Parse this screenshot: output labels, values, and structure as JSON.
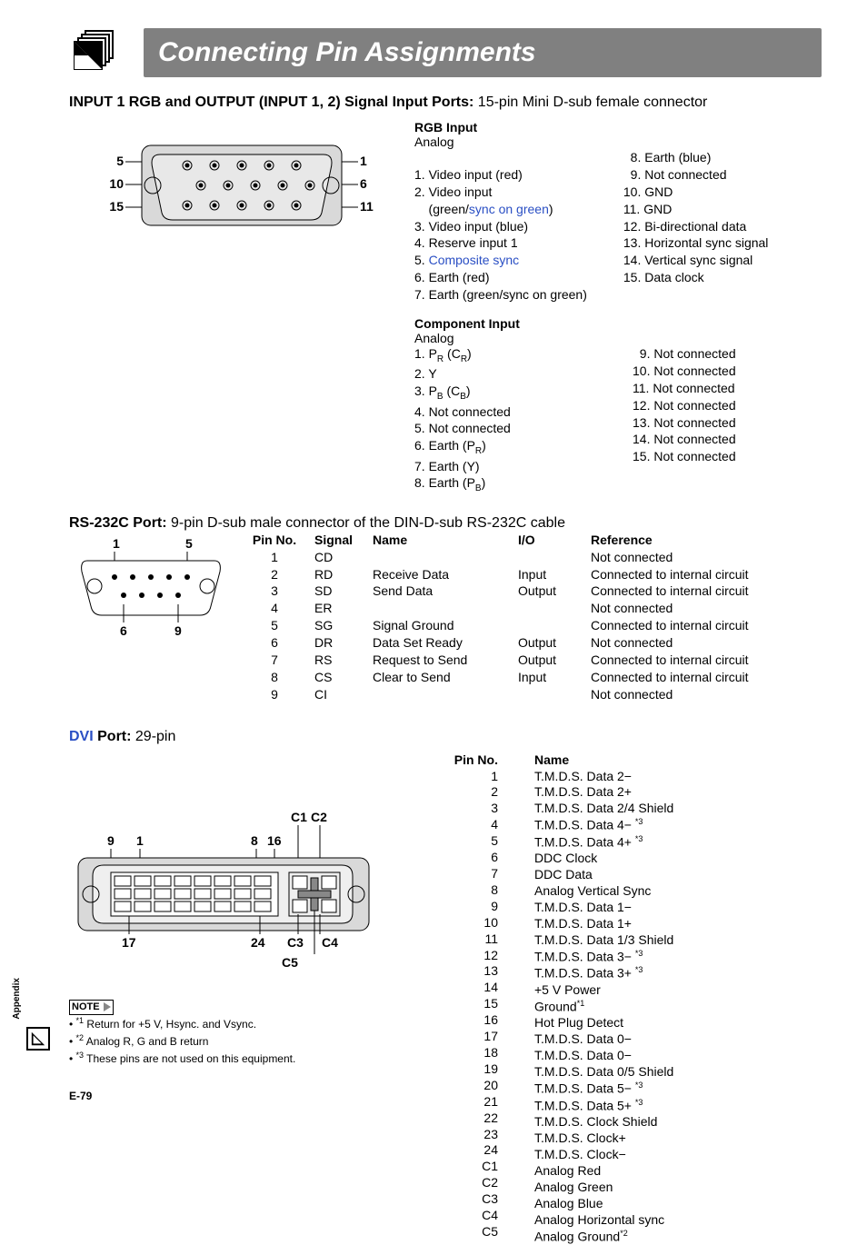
{
  "title": "Connecting Pin Assignments",
  "sideTab": "Appendix",
  "pageNum": "E-79",
  "sec1": {
    "heading_bold": "INPUT 1 RGB and OUTPUT (INPUT 1, 2) Signal Input Ports:",
    "heading_rest": " 15-pin Mini D-sub female connector",
    "rgb_head": "RGB Input",
    "rgb_sub": "Analog",
    "rgb_left": [
      "1. Video input (red)",
      "2. Video input",
      "    (green/",
      "3. Video input (blue)",
      "4. Reserve input 1",
      "5. ",
      "6. Earth (red)",
      "7. Earth (green/sync on green)"
    ],
    "rgb_sync_on_green": "sync on green",
    "rgb_close": ")",
    "rgb_composite": "Composite sync",
    "rgb_right": [
      "  8. Earth (blue)",
      "  9. Not connected",
      "10. GND",
      "11. GND",
      "12. Bi-directional data",
      "13. Horizontal sync signal",
      "14. Vertical sync signal",
      "15. Data clock"
    ],
    "comp_head": "Component Input",
    "comp_sub": "Analog",
    "comp_left_pre": "1. P",
    "comp": {
      "l1a": "1. P",
      "l1b": "R",
      "l1c": " (C",
      "l1d": "R",
      "l1e": ")",
      "l2": "2. Y",
      "l3a": "3. P",
      "l3b": "B",
      "l3c": " (C",
      "l3d": "B",
      "l3e": ")",
      "l4": "4. Not connected",
      "l5": "5. Not connected",
      "l6a": "6. Earth (P",
      "l6b": "R",
      "l6c": ")",
      "l7": "7. Earth (Y)",
      "l8a": "8. Earth (P",
      "l8b": "B",
      "l8c": ")"
    },
    "comp_right": [
      "  9. Not connected",
      "10. Not connected",
      "11. Not connected",
      "12. Not connected",
      "13. Not connected",
      "14. Not connected",
      "15. Not connected"
    ]
  },
  "sec2": {
    "heading_bold": "RS-232C Port:",
    "heading_rest": " 9-pin D-sub male connector of the DIN-D-sub RS-232C cable",
    "head": {
      "pin": "Pin No.",
      "sig": "Signal",
      "name": "Name",
      "io": "I/O",
      "ref": "Reference"
    },
    "rows": [
      {
        "pin": "1",
        "sig": "CD",
        "name": "",
        "io": "",
        "ref": "Not connected"
      },
      {
        "pin": "2",
        "sig": "RD",
        "name": "Receive Data",
        "io": "Input",
        "ref": "Connected to internal circuit"
      },
      {
        "pin": "3",
        "sig": "SD",
        "name": "Send Data",
        "io": "Output",
        "ref": "Connected to internal circuit"
      },
      {
        "pin": "4",
        "sig": "ER",
        "name": "",
        "io": "",
        "ref": "Not connected"
      },
      {
        "pin": "5",
        "sig": "SG",
        "name": "Signal Ground",
        "io": "",
        "ref": "Connected to internal circuit"
      },
      {
        "pin": "6",
        "sig": "DR",
        "name": "Data Set Ready",
        "io": "Output",
        "ref": "Not connected"
      },
      {
        "pin": "7",
        "sig": "RS",
        "name": "Request to Send",
        "io": "Output",
        "ref": "Connected to internal circuit"
      },
      {
        "pin": "8",
        "sig": "CS",
        "name": "Clear to Send",
        "io": "Input",
        "ref": "Connected to internal circuit"
      },
      {
        "pin": "9",
        "sig": "CI",
        "name": "",
        "io": "",
        "ref": "Not connected"
      }
    ]
  },
  "sec3": {
    "heading_link": "DVI",
    "heading_bold": " Port:",
    "heading_rest": " 29-pin",
    "head": {
      "pin": "Pin No.",
      "name": "Name"
    },
    "rows": [
      {
        "pin": "1",
        "name": "T.M.D.S. Data 2−"
      },
      {
        "pin": "2",
        "name": "T.M.D.S. Data 2+"
      },
      {
        "pin": "3",
        "name": "T.M.D.S. Data 2/4 Shield"
      },
      {
        "pin": "4",
        "name": "T.M.D.S. Data 4− ",
        "sup": "*3"
      },
      {
        "pin": "5",
        "name": "T.M.D.S. Data 4+ ",
        "sup": "*3"
      },
      {
        "pin": "6",
        "name": "DDC Clock"
      },
      {
        "pin": "7",
        "name": "DDC Data"
      },
      {
        "pin": "8",
        "name": "Analog Vertical Sync"
      },
      {
        "pin": "9",
        "name": "T.M.D.S. Data 1−"
      },
      {
        "pin": "10",
        "name": "T.M.D.S. Data 1+"
      },
      {
        "pin": "11",
        "name": "T.M.D.S. Data 1/3 Shield"
      },
      {
        "pin": "12",
        "name": "T.M.D.S. Data 3− ",
        "sup": "*3"
      },
      {
        "pin": "13",
        "name": "T.M.D.S. Data 3+ ",
        "sup": "*3"
      },
      {
        "pin": "14",
        "name": "+5 V Power"
      },
      {
        "pin": "15",
        "name": "Ground",
        "sup": "*1"
      },
      {
        "pin": "16",
        "name": "Hot Plug Detect"
      },
      {
        "pin": "17",
        "name": "T.M.D.S. Data 0−"
      },
      {
        "pin": "18",
        "name": "T.M.D.S. Data 0−"
      },
      {
        "pin": "19",
        "name": "T.M.D.S. Data 0/5 Shield"
      },
      {
        "pin": "20",
        "name": "T.M.D.S. Data 5− ",
        "sup": "*3"
      },
      {
        "pin": "21",
        "name": "T.M.D.S. Data 5+ ",
        "sup": "*3"
      },
      {
        "pin": "22",
        "name": "T.M.D.S. Clock Shield"
      },
      {
        "pin": "23",
        "name": "T.M.D.S. Clock+"
      },
      {
        "pin": "24",
        "name": "T.M.D.S. Clock−"
      },
      {
        "pin": "C1",
        "name": "Analog Red"
      },
      {
        "pin": "C2",
        "name": "Analog Green"
      },
      {
        "pin": "C3",
        "name": "Analog Blue"
      },
      {
        "pin": "C4",
        "name": "Analog Horizontal sync"
      },
      {
        "pin": "C5",
        "name": "Analog Ground",
        "sup": "*2"
      }
    ],
    "noteLabel": "NOTE",
    "notes": [
      {
        "sup": "*1",
        "txt": " Return for +5 V, Hsync. and Vsync."
      },
      {
        "sup": "*2",
        "txt": " Analog R, G and B return"
      },
      {
        "sup": "*3",
        "txt": " These pins are not used on this equipment."
      }
    ]
  },
  "diagram_labels": {
    "db15": {
      "l5": "5",
      "l10": "10",
      "l15": "15",
      "r1": "1",
      "r6": "6",
      "r11": "11"
    },
    "db9": {
      "l1": "1",
      "l5": "5",
      "l6": "6",
      "l9": "9"
    },
    "dvi": {
      "a9": "9",
      "a1": "1",
      "a8": "8",
      "a16": "16",
      "a17": "17",
      "a24": "24",
      "c1": "C1",
      "c2": "C2",
      "c3": "C3",
      "c4": "C4",
      "c5": "C5"
    }
  }
}
